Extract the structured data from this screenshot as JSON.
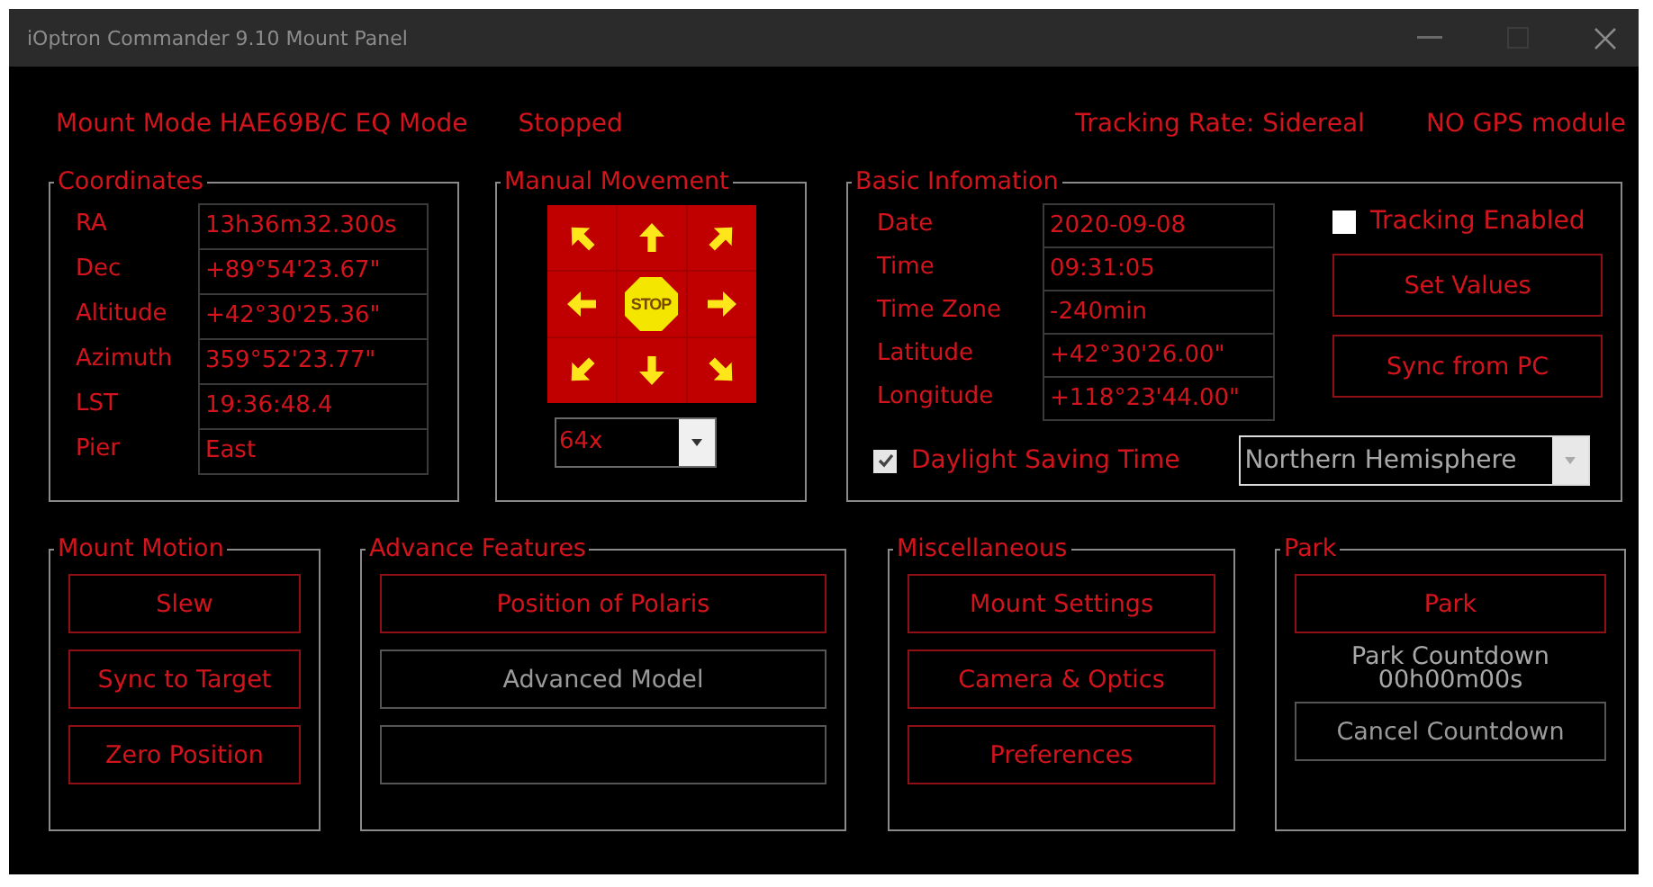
{
  "window": {
    "title": "iOptron Commander 9.10 Mount Panel"
  },
  "status_bar": {
    "mount_mode": "Mount Mode HAE69B/C EQ Mode",
    "state": "Stopped",
    "tracking_rate": "Tracking Rate: Sidereal",
    "gps": "NO GPS module"
  },
  "coordinates": {
    "title": "Coordinates",
    "rows": [
      {
        "label": "RA",
        "value": "13h36m32.300s"
      },
      {
        "label": "Dec",
        "value": "+89°54'23.67\""
      },
      {
        "label": "Altitude",
        "value": "+42°30'25.36\""
      },
      {
        "label": "Azimuth",
        "value": "359°52'23.77\""
      },
      {
        "label": "LST",
        "value": "19:36:48.4"
      },
      {
        "label": "Pier",
        "value": "East"
      }
    ]
  },
  "manual_movement": {
    "title": "Manual Movement",
    "pad": [
      {
        "kind": "nw"
      },
      {
        "kind": "n"
      },
      {
        "kind": "ne"
      },
      {
        "kind": "w"
      },
      {
        "kind": "stop",
        "label": "STOP"
      },
      {
        "kind": "e"
      },
      {
        "kind": "sw"
      },
      {
        "kind": "s"
      },
      {
        "kind": "se"
      }
    ],
    "speed": {
      "value": "64x"
    }
  },
  "basic_information": {
    "title": "Basic Infomation",
    "rows": [
      {
        "label": "Date",
        "value": "2020-09-08"
      },
      {
        "label": "Time",
        "value": "09:31:05"
      },
      {
        "label": "Time Zone",
        "value": "-240min"
      },
      {
        "label": "Latitude",
        "value": "+42°30'26.00\""
      },
      {
        "label": "Longitude",
        "value": "+118°23'44.00\""
      }
    ],
    "tracking_enabled": {
      "label": "Tracking Enabled",
      "checked": false
    },
    "buttons": [
      {
        "label": "Set Values",
        "disabled": false
      },
      {
        "label": "Sync from PC",
        "disabled": false
      }
    ],
    "daylight_saving": {
      "label": "Daylight Saving Time",
      "checked": true
    },
    "hemisphere": {
      "value": "Northern Hemisphere"
    }
  },
  "groups": [
    {
      "title": "Mount Motion",
      "items": [
        {
          "kind": "button",
          "label": "Slew",
          "disabled": false
        },
        {
          "kind": "button",
          "label": "Sync to Target",
          "disabled": false
        },
        {
          "kind": "button",
          "label": "Zero Position",
          "disabled": false
        }
      ]
    },
    {
      "title": "Advance Features",
      "items": [
        {
          "kind": "button",
          "label": "Position of Polaris",
          "disabled": false
        },
        {
          "kind": "button",
          "label": "Advanced Model",
          "disabled": true
        },
        {
          "kind": "button",
          "disabled": true
        }
      ]
    },
    {
      "title": "Miscellaneous",
      "items": [
        {
          "kind": "button",
          "label": "Mount Settings",
          "disabled": false
        },
        {
          "kind": "button",
          "label": "Camera & Optics",
          "disabled": false
        },
        {
          "kind": "button",
          "label": "Preferences",
          "disabled": false
        }
      ]
    },
    {
      "title": "Park",
      "items": [
        {
          "kind": "button",
          "label": "Park",
          "disabled": false
        },
        {
          "kind": "text",
          "label": "Park Countdown"
        },
        {
          "kind": "text",
          "label": "00h00m00s"
        },
        {
          "kind": "button",
          "label": "Cancel Countdown",
          "disabled": true
        }
      ]
    }
  ]
}
